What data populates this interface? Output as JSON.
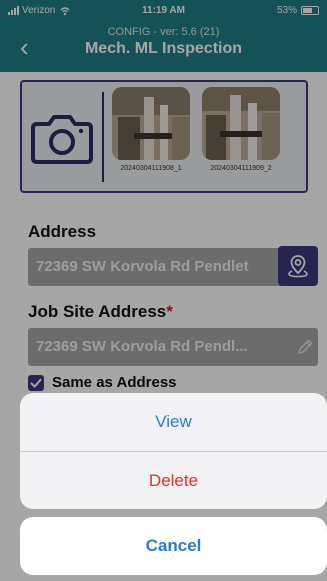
{
  "status_bar": {
    "carrier": "Verizon",
    "time": "11:19 AM",
    "battery": "53%"
  },
  "header": {
    "config": "CONFIG - ver: 5.6 (21)",
    "title": "Mech. ML Inspection"
  },
  "photos": [
    {
      "caption": "20240304111908_1"
    },
    {
      "caption": "20240304111909_2"
    }
  ],
  "address": {
    "label": "Address",
    "value": "72369 SW Korvola Rd Pendlet"
  },
  "job_site": {
    "label": "Job Site Address",
    "required_mark": "*",
    "value": "72369 SW Korvola Rd Pendl..."
  },
  "same_as_address": {
    "label": "Same as Address",
    "checked": true
  },
  "action_sheet": {
    "view_label": "View",
    "delete_label": "Delete",
    "cancel_label": "Cancel"
  },
  "colors": {
    "header_teal": "#1f7f86",
    "accent_indigo": "#3d3a7a",
    "action_blue": "#2a7ad8",
    "destructive_red": "#e0342f",
    "required_red": "#d21f1f"
  },
  "icons": [
    "signal-icon",
    "wifi-icon",
    "battery-icon",
    "back-chevron-icon",
    "camera-icon",
    "map-pin-icon",
    "pencil-icon",
    "checkmark-icon"
  ]
}
